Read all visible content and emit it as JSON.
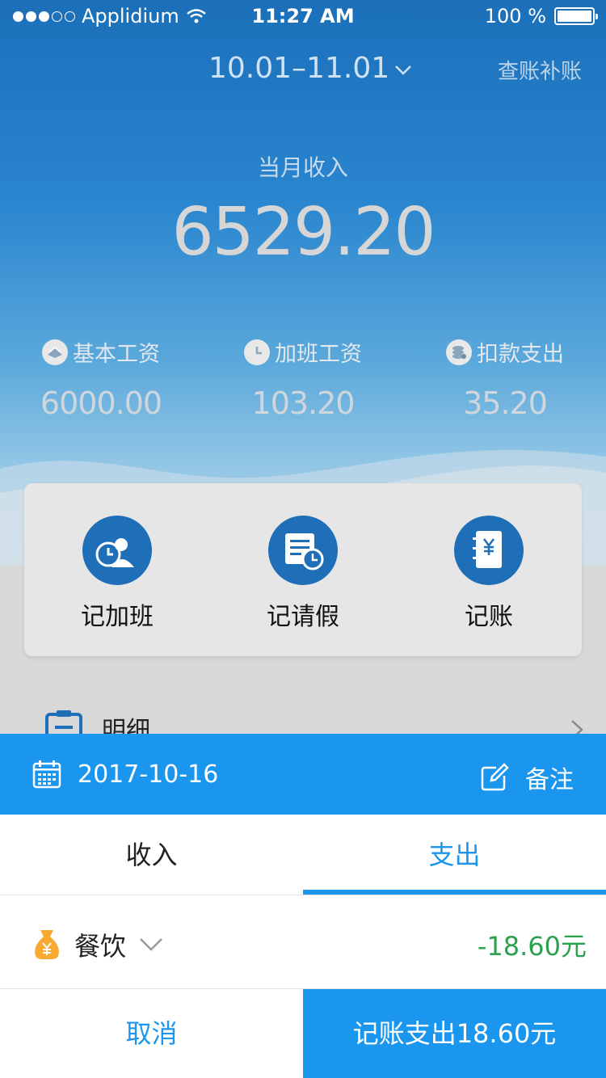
{
  "status_bar": {
    "carrier": "Applidium",
    "time": "11:27 AM",
    "battery": "100 %"
  },
  "header": {
    "period": "10.01–11.01",
    "audit_link": "查账补账"
  },
  "summary": {
    "label": "当月收入",
    "value": "6529.20"
  },
  "stats": [
    {
      "icon": "salary-icon",
      "label": "基本工资",
      "value": "6000.00"
    },
    {
      "icon": "clock-icon",
      "label": "加班工资",
      "value": "103.20"
    },
    {
      "icon": "coins-icon",
      "label": "扣款支出",
      "value": "35.20"
    }
  ],
  "actions": [
    {
      "icon": "overtime-icon",
      "label": "记加班"
    },
    {
      "icon": "leave-icon",
      "label": "记请假"
    },
    {
      "icon": "ledger-icon",
      "label": "记账"
    }
  ],
  "detail": {
    "label": "明细"
  },
  "sheet": {
    "date": "2017-10-16",
    "note_label": "备注",
    "tabs": [
      {
        "label": "收入",
        "active": false
      },
      {
        "label": "支出",
        "active": true
      }
    ],
    "category": "餐饮",
    "amount": "-18.60元",
    "cancel_label": "取消",
    "confirm_label": "记账支出18.60元"
  },
  "colors": {
    "accent": "#1b96ee",
    "action_blue": "#1e6fb8",
    "amount_green": "#2ba14d",
    "bag_orange": "#f7a931"
  }
}
